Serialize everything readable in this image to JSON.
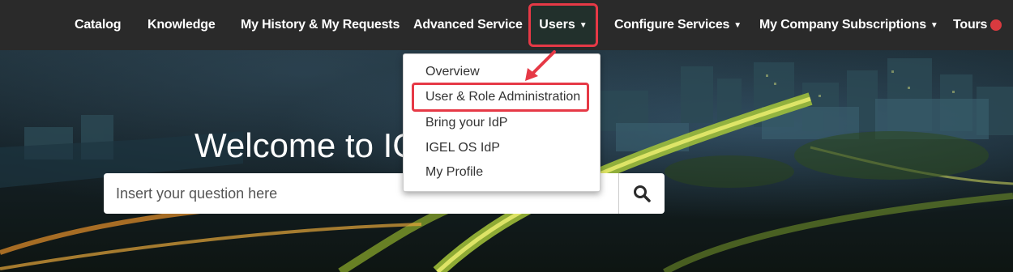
{
  "nav": {
    "items": [
      {
        "label": "Catalog"
      },
      {
        "label": "Knowledge"
      },
      {
        "label": "My History & My Requests"
      },
      {
        "label": "Advanced Service"
      },
      {
        "label": "Users"
      },
      {
        "label": "Configure Services"
      },
      {
        "label": "My Company Subscriptions"
      },
      {
        "label": "Tours"
      }
    ]
  },
  "hero": {
    "welcome": "Welcome to IGE",
    "search_placeholder": "Insert your question here"
  },
  "dropdown": {
    "items": [
      {
        "label": "Overview"
      },
      {
        "label": "User & Role Administration"
      },
      {
        "label": "Bring your IdP"
      },
      {
        "label": "IGEL OS IdP"
      },
      {
        "label": "My Profile"
      }
    ]
  },
  "colors": {
    "nav_bg": "#2a2a2a",
    "highlight": "#e63946",
    "tours_dot": "#d93a3f"
  }
}
